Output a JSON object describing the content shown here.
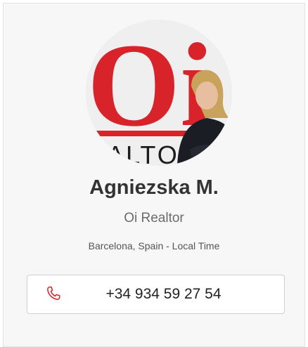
{
  "profile": {
    "name": "Agniezska M.",
    "company": "Oi Realtor",
    "location": "Barcelona, Spain - Local Time",
    "photo_logo_text": "Oi",
    "photo_sign_text": "ALTO"
  },
  "contact": {
    "phone": "+34 934 59 27 54",
    "phone_icon": "phone-icon"
  },
  "colors": {
    "brand_red": "#d8232a",
    "card_bg": "#f7f7f7"
  }
}
